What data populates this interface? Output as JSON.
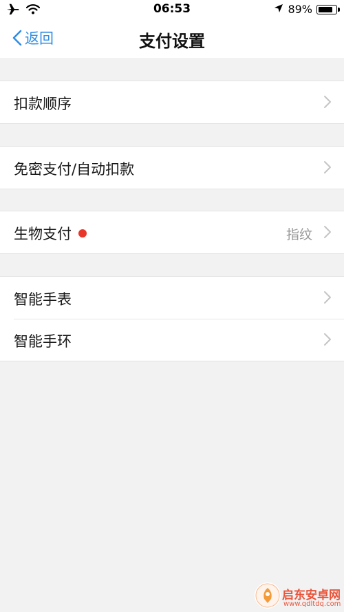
{
  "status_bar": {
    "time": "06:53",
    "battery_percent": "89%",
    "battery_level": 0.89,
    "icons": [
      "airplane-icon",
      "wifi-icon",
      "location-arrow-icon",
      "battery-icon"
    ]
  },
  "nav": {
    "back_label": "返回",
    "title": "支付设置"
  },
  "groups": [
    {
      "rows": [
        {
          "label": "扣款顺序"
        }
      ]
    },
    {
      "rows": [
        {
          "label": "免密支付/自动扣款"
        }
      ]
    },
    {
      "rows": [
        {
          "label": "生物支付",
          "value": "指纹",
          "badge": "red-dot"
        }
      ]
    },
    {
      "rows": [
        {
          "label": "智能手表"
        },
        {
          "label": "智能手环"
        }
      ]
    }
  ],
  "watermark": {
    "title": "启东安卓网",
    "url": "www.qdltdq.com"
  },
  "colors": {
    "accent": "#2f8de4",
    "badge_red": "#e8362b",
    "background": "#f2f2f2",
    "chevron": "#c4c4c4",
    "value_text": "#999999",
    "watermark": "#e9543a"
  }
}
